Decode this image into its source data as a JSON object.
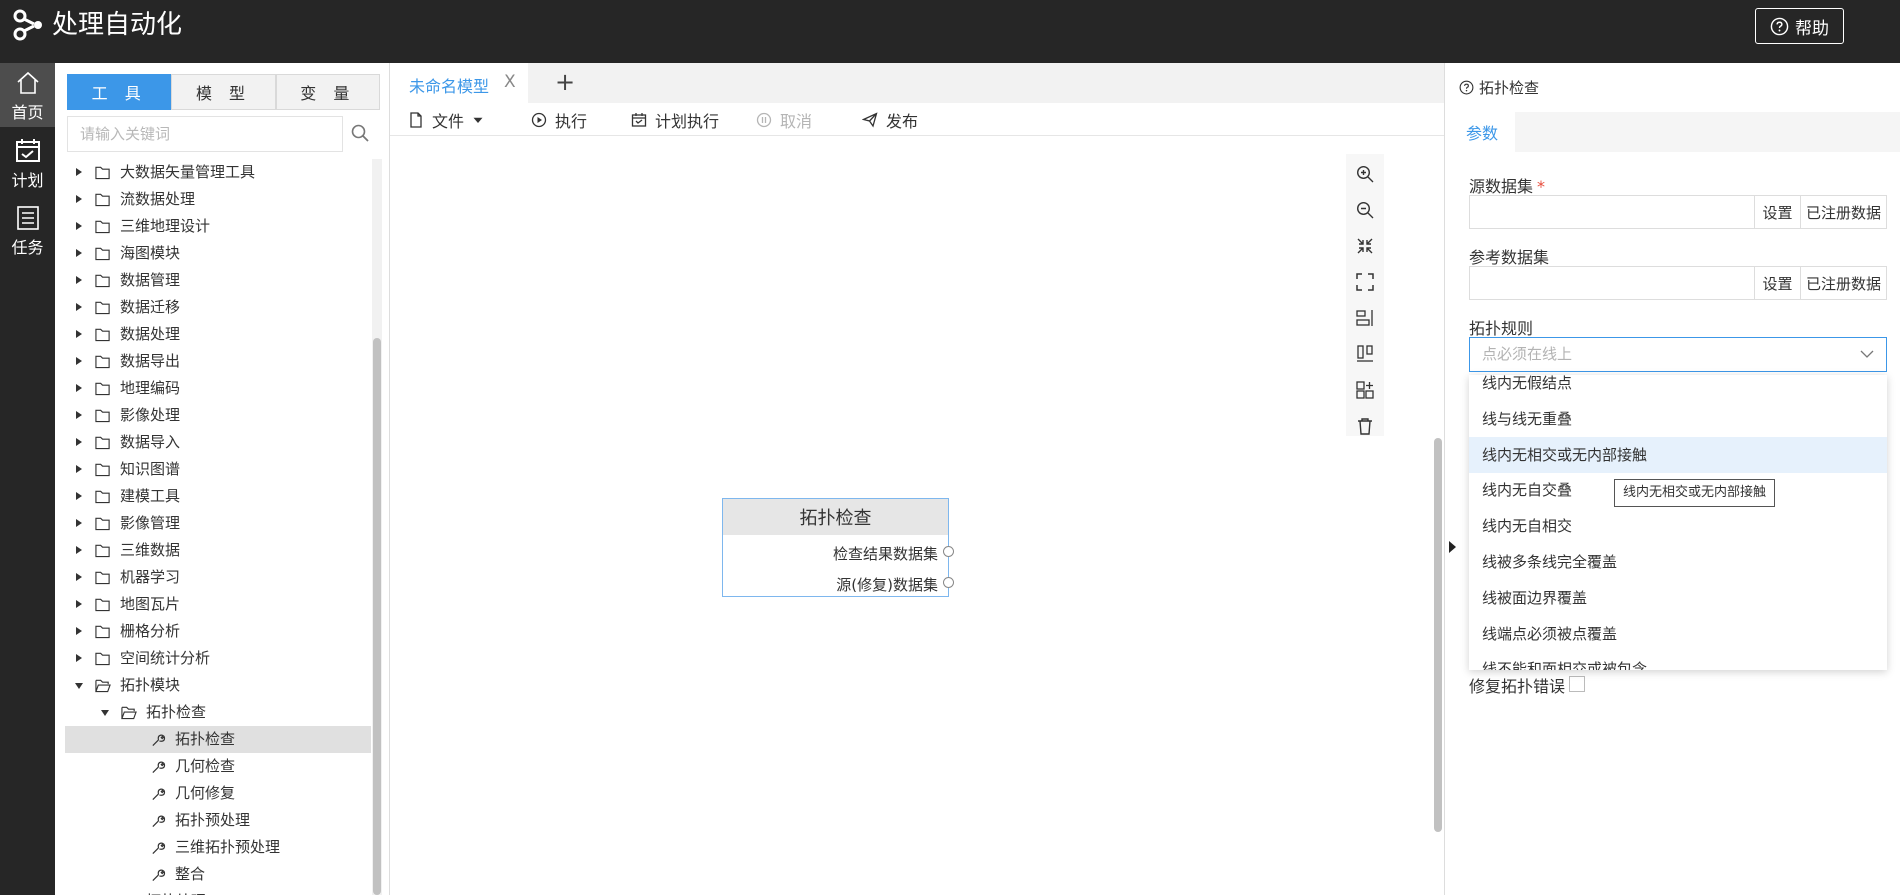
{
  "app": {
    "title": "处理自动化",
    "help_label": "帮助"
  },
  "rail": {
    "items": [
      {
        "label": "首页",
        "icon": "home-icon",
        "active": true
      },
      {
        "label": "计划",
        "icon": "calendar-icon"
      },
      {
        "label": "任务",
        "icon": "list-icon"
      }
    ]
  },
  "left_panel": {
    "tabs": [
      "工 具",
      "模 型",
      "变 量"
    ],
    "active_tab": 0,
    "search_placeholder": "请输入关键词",
    "tree": [
      {
        "label": "大数据矢量管理工具",
        "type": "folder",
        "level": 0
      },
      {
        "label": "流数据处理",
        "type": "folder",
        "level": 0
      },
      {
        "label": "三维地理设计",
        "type": "folder",
        "level": 0
      },
      {
        "label": "海图模块",
        "type": "folder",
        "level": 0
      },
      {
        "label": "数据管理",
        "type": "folder",
        "level": 0
      },
      {
        "label": "数据迁移",
        "type": "folder",
        "level": 0
      },
      {
        "label": "数据处理",
        "type": "folder",
        "level": 0
      },
      {
        "label": "数据导出",
        "type": "folder",
        "level": 0
      },
      {
        "label": "地理编码",
        "type": "folder",
        "level": 0
      },
      {
        "label": "影像处理",
        "type": "folder",
        "level": 0
      },
      {
        "label": "数据导入",
        "type": "folder",
        "level": 0
      },
      {
        "label": "知识图谱",
        "type": "folder",
        "level": 0
      },
      {
        "label": "建模工具",
        "type": "folder",
        "level": 0
      },
      {
        "label": "影像管理",
        "type": "folder",
        "level": 0
      },
      {
        "label": "三维数据",
        "type": "folder",
        "level": 0
      },
      {
        "label": "机器学习",
        "type": "folder",
        "level": 0
      },
      {
        "label": "地图瓦片",
        "type": "folder",
        "level": 0
      },
      {
        "label": "栅格分析",
        "type": "folder",
        "level": 0
      },
      {
        "label": "空间统计分析",
        "type": "folder",
        "level": 0
      },
      {
        "label": "拓扑模块",
        "type": "folder-open",
        "level": 0
      },
      {
        "label": "拓扑检查",
        "type": "folder-open",
        "level": 1
      },
      {
        "label": "拓扑检查",
        "type": "tool",
        "level": 2,
        "selected": true
      },
      {
        "label": "几何检查",
        "type": "tool",
        "level": 2
      },
      {
        "label": "几何修复",
        "type": "tool",
        "level": 2
      },
      {
        "label": "拓扑预处理",
        "type": "tool",
        "level": 2
      },
      {
        "label": "三维拓扑预处理",
        "type": "tool",
        "level": 2
      },
      {
        "label": "整合",
        "type": "tool",
        "level": 2
      },
      {
        "label": "拓扑处理",
        "type": "folder-open",
        "level": 1
      }
    ]
  },
  "editor": {
    "tab_name": "未命名模型",
    "tab_close": "X",
    "add_tab": "+",
    "toolbar": {
      "file": "文件",
      "run": "执行",
      "schedule": "计划执行",
      "cancel": "取消",
      "publish": "发布"
    },
    "node": {
      "title": "拓扑检查",
      "ports": [
        "检查结果数据集",
        "源(修复)数据集"
      ]
    },
    "canvas_tools": [
      "zoom-in-icon",
      "zoom-out-icon",
      "fit-icon",
      "fullscreen-icon",
      "align-horizontal-icon",
      "align-vertical-icon",
      "layout-icon",
      "delete-icon"
    ]
  },
  "properties": {
    "title": "拓扑检查",
    "tab": "参数",
    "source_label": "源数据集",
    "ref_label": "参考数据集",
    "set_label": "设置",
    "registered_label": "已注册数据",
    "rule_label": "拓扑规则",
    "rule_placeholder": "点必须在线上",
    "dropdown_options": [
      "线内无假结点",
      "线与线无重叠",
      "线内无相交或无内部接触",
      "线内无自交叠",
      "线内无自相交",
      "线被多条线完全覆盖",
      "线被面边界覆盖",
      "线端点必须被点覆盖",
      "线不能和面相交或被包含"
    ],
    "hovered_option": 2,
    "tooltip": "线内无相交或无内部接触",
    "repair_label": "修复拓扑错误"
  },
  "colors": {
    "accent": "#3c97e8",
    "header": "#262626",
    "required": "#e74c3c"
  }
}
